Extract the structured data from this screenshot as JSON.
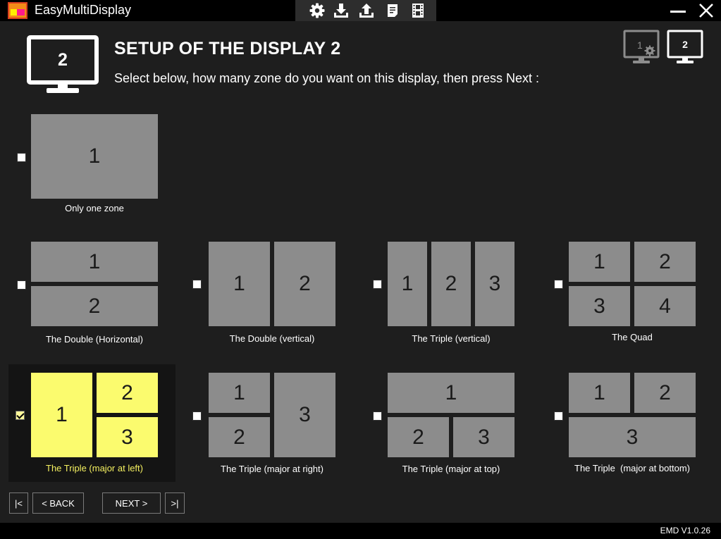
{
  "app": {
    "title": "EasyMultiDisplay",
    "version": "EMD V1.0.26"
  },
  "toolbar": {
    "icons": [
      "gear-icon",
      "download-icon",
      "upload-icon",
      "document-icon",
      "film-icon"
    ]
  },
  "header": {
    "display_number": "2",
    "title": "SETUP OF THE DISPLAY 2",
    "subtitle": "Select below, how many zone do you want on this display, then press Next :",
    "display_buttons": [
      "1",
      "2"
    ]
  },
  "options": {
    "single": {
      "label": "Only one zone",
      "zones": [
        "1"
      ],
      "checked": false
    },
    "double_h": {
      "label": "The Double (Horizontal)",
      "zones": [
        "1",
        "2"
      ],
      "checked": false
    },
    "double_v": {
      "label": "The Double (vertical)",
      "zones": [
        "1",
        "2"
      ],
      "checked": false
    },
    "triple_v": {
      "label": "The Triple (vertical)",
      "zones": [
        "1",
        "2",
        "3"
      ],
      "checked": false
    },
    "quad": {
      "label": "The Quad",
      "zones": [
        "1",
        "2",
        "3",
        "4"
      ],
      "checked": false
    },
    "triple_left": {
      "label": "The Triple (major at left)",
      "zones": [
        "1",
        "2",
        "3"
      ],
      "checked": true
    },
    "triple_right": {
      "label": "The Triple (major at right)",
      "zones": [
        "1",
        "2",
        "3"
      ],
      "checked": false
    },
    "triple_top": {
      "label": "The Triple (major at top)",
      "zones": [
        "1",
        "2",
        "3"
      ],
      "checked": false
    },
    "triple_bottom": {
      "label": "The Triple  (major at bottom)",
      "zones": [
        "1",
        "2",
        "3"
      ],
      "checked": false
    }
  },
  "nav": {
    "first": "|<",
    "back": "< BACK",
    "next": "NEXT >",
    "last": ">|"
  },
  "colors": {
    "zone": "#8c8c8c",
    "zone_selected": "#fbfb6e",
    "background": "#1e1e1e",
    "selected_label": "#f4f060"
  }
}
